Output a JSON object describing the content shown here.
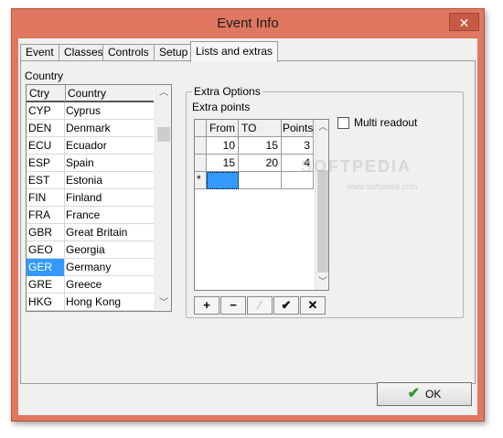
{
  "window": {
    "title": "Event Info",
    "close_glyph": "✕"
  },
  "tabs": [
    {
      "label": "Event"
    },
    {
      "label": "Classes"
    },
    {
      "label": "Controls"
    },
    {
      "label": "Setup"
    },
    {
      "label": "Lists and extras"
    }
  ],
  "active_tab": "Lists and extras",
  "country": {
    "group_label": "Country",
    "columns": [
      "Ctry",
      "Country"
    ],
    "rows": [
      {
        "code": "CYP",
        "name": "Cyprus"
      },
      {
        "code": "DEN",
        "name": "Denmark"
      },
      {
        "code": "ECU",
        "name": "Ecuador"
      },
      {
        "code": "ESP",
        "name": "Spain"
      },
      {
        "code": "EST",
        "name": "Estonia"
      },
      {
        "code": "FIN",
        "name": "Finland"
      },
      {
        "code": "FRA",
        "name": "France"
      },
      {
        "code": "GBR",
        "name": "Great Britain"
      },
      {
        "code": "GEO",
        "name": "Georgia"
      },
      {
        "code": "GER",
        "name": "Germany"
      },
      {
        "code": "GRE",
        "name": "Greece"
      },
      {
        "code": "HKG",
        "name": "Hong Kong"
      }
    ],
    "selected_code": "GER"
  },
  "extra_options": {
    "group_label": "Extra Options",
    "points_label": "Extra points",
    "columns": [
      "From",
      "TO",
      "Points"
    ],
    "rows": [
      {
        "from": "10",
        "to": "15",
        "points": "3"
      },
      {
        "from": "15",
        "to": "20",
        "points": "4"
      }
    ],
    "new_row_marker": "*",
    "multi_readout_label": "Multi readout",
    "multi_readout_checked": false,
    "navigator": [
      {
        "glyph": "+",
        "name": "insert-button"
      },
      {
        "glyph": "−",
        "name": "delete-button"
      },
      {
        "glyph": "⁄",
        "name": "edit-button"
      },
      {
        "glyph": "✔",
        "name": "post-button"
      },
      {
        "glyph": "✕",
        "name": "cancel-button"
      }
    ]
  },
  "ok_button": {
    "label": "OK",
    "icon": "checkmark-icon"
  },
  "watermark": {
    "main": "SOFTPEDIA",
    "sub": "www.softpedia.com"
  },
  "colors": {
    "window_frame": "#e07760",
    "selection": "#3399ff",
    "ok_check": "#2e9a2e"
  }
}
